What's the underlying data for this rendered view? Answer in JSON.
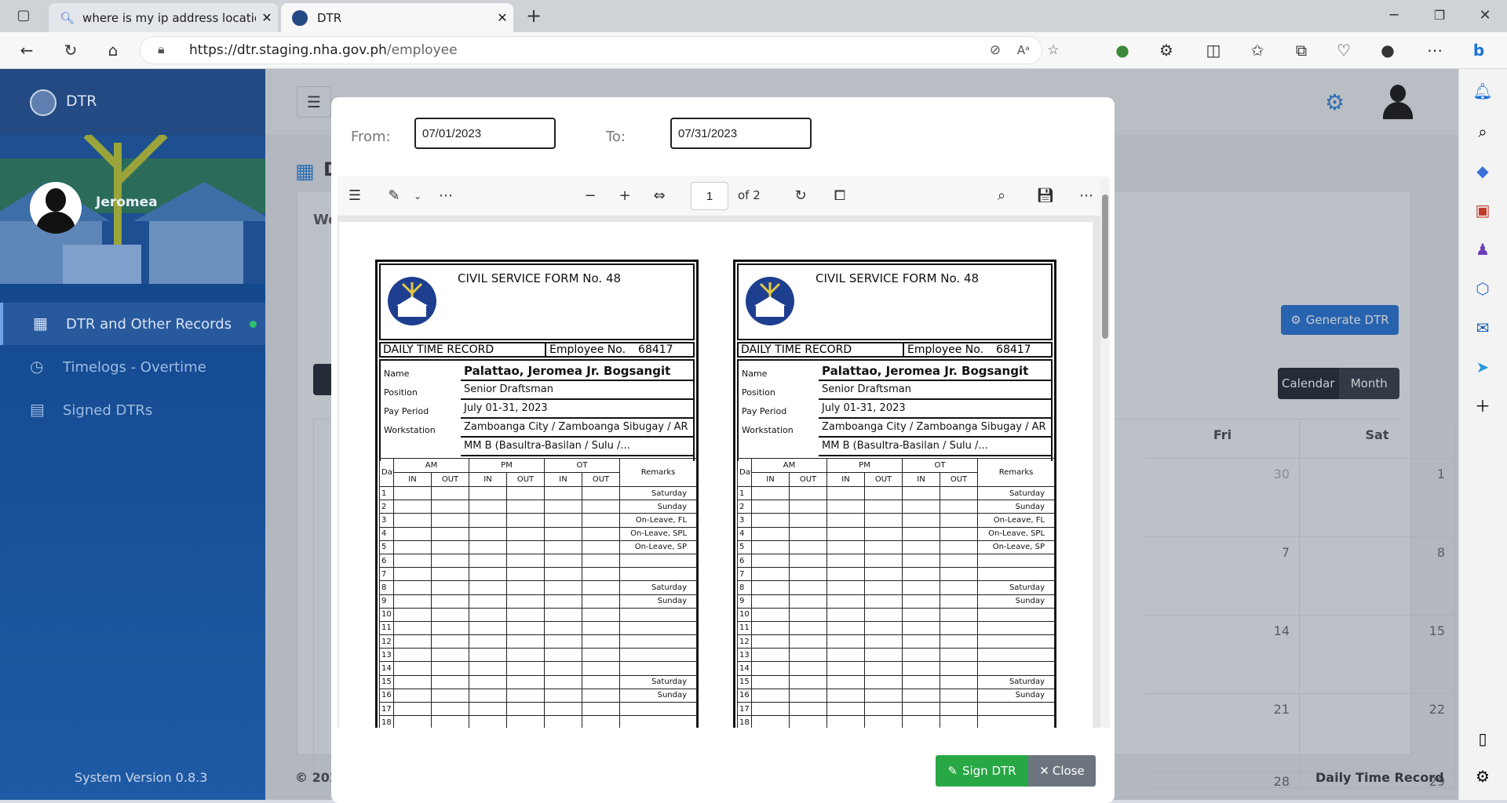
{
  "browser": {
    "tabs": [
      {
        "title": "where is my ip address location -",
        "icon": "search-icon"
      },
      {
        "title": "DTR",
        "icon": "nha-logo-icon"
      }
    ],
    "new_tab": "+",
    "url_host": "https://dtr.staging.nha.gov.ph",
    "url_path": "/employee",
    "notification_badge": "1"
  },
  "sidebar": {
    "brand": "DTR",
    "user_name": "Jeromea",
    "items": [
      {
        "label": "DTR and Other Records",
        "active": true,
        "icon": "calendar-icon"
      },
      {
        "label": "Timelogs - Overtime",
        "active": false,
        "icon": "clock-icon"
      },
      {
        "label": "Signed DTRs",
        "active": false,
        "icon": "pdf-file-icon"
      }
    ],
    "version": "System Version 0.8.3"
  },
  "main": {
    "heading_partial": "D",
    "welcome_partial": "We",
    "generate_button": "Generate DTR",
    "view_toggle": [
      "Calendar",
      "Month"
    ],
    "calendar": {
      "headers": [
        "Fri",
        "Sat"
      ],
      "rows": [
        [
          "30",
          "1"
        ],
        [
          "7",
          "8"
        ],
        [
          "14",
          "15"
        ],
        [
          "21",
          "22"
        ],
        [
          "28",
          "29"
        ]
      ]
    },
    "footer_left": "© 202",
    "footer_right": "Daily Time Record"
  },
  "modal": {
    "from_label": "From:",
    "from_value": "07/01/2023",
    "to_label": "To:",
    "to_value": "07/31/2023",
    "pdf_toolbar": {
      "page_number": "1",
      "page_total": "of 2"
    },
    "form": {
      "title": "CIVIL SERVICE FORM No. 48",
      "record_title": "DAILY TIME RECORD",
      "employee_no_label": "Employee No.",
      "employee_no": "68417",
      "name_label": "Name",
      "name": "Palattao, Jeromea Jr. Bogsangit",
      "position_label": "Position",
      "position": "Senior Draftsman",
      "pay_period_label": "Pay Period",
      "pay_period": "July 01-31, 2023",
      "workstation_label": "Workstation",
      "workstation_line1": "Zamboanga City / Zamboanga Sibugay / AR",
      "workstation_line2": "MM B (Basultra-Basilan / Sulu /...",
      "col_day": "Day",
      "col_am": "AM",
      "col_pm": "PM",
      "col_ot": "OT",
      "col_in": "IN",
      "col_out": "OUT",
      "col_remarks": "Remarks",
      "remarks": [
        "Saturday",
        "Sunday",
        "On-Leave, FL",
        "On-Leave, SPL",
        "On-Leave, SP",
        "",
        "",
        "Saturday",
        "Sunday",
        "",
        "",
        "",
        "",
        "",
        "Saturday",
        "Sunday",
        "",
        "",
        ""
      ]
    },
    "sign_button": "Sign DTR",
    "close_button": "Close"
  }
}
